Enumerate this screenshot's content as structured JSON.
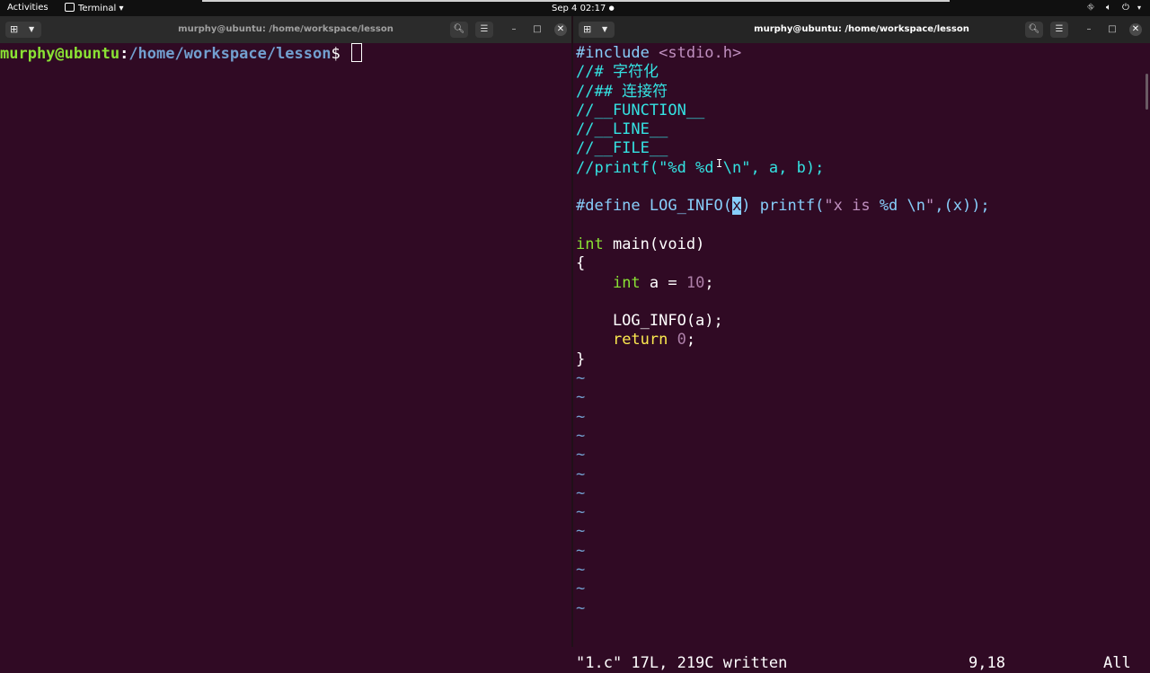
{
  "topbar": {
    "activities": "Activities",
    "app_menu": "Terminal",
    "app_menu_caret": "▾",
    "datetime": "Sep 4  02:17",
    "indicator": "●"
  },
  "left_terminal": {
    "title": "murphy@ubuntu: /home/workspace/lesson",
    "prompt_user": "murphy@ubuntu",
    "prompt_colon": ":",
    "prompt_path": "/home/workspace/lesson",
    "prompt_suffix": "$ "
  },
  "right_terminal": {
    "title": "murphy@ubuntu: /home/workspace/lesson",
    "code": [
      [
        {
          "t": "#include ",
          "c": "c-pre"
        },
        {
          "t": "<stdio.h>",
          "c": "c-str"
        }
      ],
      [
        {
          "t": "//# 字符化",
          "c": "c-cmt"
        }
      ],
      [
        {
          "t": "//## 连接符",
          "c": "c-cmt"
        }
      ],
      [
        {
          "t": "//__FUNCTION__",
          "c": "c-cmt"
        }
      ],
      [
        {
          "t": "//__LINE__",
          "c": "c-cmt"
        }
      ],
      [
        {
          "t": "//__FILE__",
          "c": "c-cmt"
        }
      ],
      [
        {
          "t": "//printf(\"%d %d \\n\", a, b);",
          "c": "c-cmt"
        }
      ],
      [],
      [
        {
          "t": "#define LOG_INFO(",
          "c": "c-pre"
        },
        {
          "t": "x",
          "c": "c-pre cur"
        },
        {
          "t": ") ",
          "c": "c-pre"
        },
        {
          "t": "printf(",
          "c": "c-pre"
        },
        {
          "t": "\"x is ",
          "c": "c-str"
        },
        {
          "t": "%d \\n",
          "c": "c-pre"
        },
        {
          "t": "\"",
          "c": "c-str"
        },
        {
          "t": ",(x));",
          "c": "c-pre"
        }
      ],
      [],
      [
        {
          "t": "int",
          "c": "c-type"
        },
        {
          "t": " main(void)",
          "c": ""
        }
      ],
      [
        {
          "t": "{",
          "c": ""
        }
      ],
      [
        {
          "t": "    ",
          "c": ""
        },
        {
          "t": "int",
          "c": "c-type"
        },
        {
          "t": " a = ",
          "c": ""
        },
        {
          "t": "10",
          "c": "c-num"
        },
        {
          "t": ";",
          "c": ""
        }
      ],
      [],
      [
        {
          "t": "    LOG_INFO(a);",
          "c": ""
        }
      ],
      [
        {
          "t": "    ",
          "c": ""
        },
        {
          "t": "return",
          "c": "c-kw"
        },
        {
          "t": " ",
          "c": ""
        },
        {
          "t": "0",
          "c": "c-num"
        },
        {
          "t": ";",
          "c": ""
        }
      ],
      [
        {
          "t": "}",
          "c": ""
        }
      ],
      [
        {
          "t": "~",
          "c": "c-tilde"
        }
      ],
      [
        {
          "t": "~",
          "c": "c-tilde"
        }
      ],
      [
        {
          "t": "~",
          "c": "c-tilde"
        }
      ],
      [
        {
          "t": "~",
          "c": "c-tilde"
        }
      ],
      [
        {
          "t": "~",
          "c": "c-tilde"
        }
      ],
      [
        {
          "t": "~",
          "c": "c-tilde"
        }
      ],
      [
        {
          "t": "~",
          "c": "c-tilde"
        }
      ],
      [
        {
          "t": "~",
          "c": "c-tilde"
        }
      ],
      [
        {
          "t": "~",
          "c": "c-tilde"
        }
      ],
      [
        {
          "t": "~",
          "c": "c-tilde"
        }
      ],
      [
        {
          "t": "~",
          "c": "c-tilde"
        }
      ],
      [
        {
          "t": "~",
          "c": "c-tilde"
        }
      ],
      [
        {
          "t": "~",
          "c": "c-tilde"
        }
      ]
    ],
    "status_message": "\"1.c\" 17L, 219C written",
    "cursor_position": "9,18",
    "scroll_percent": "All"
  },
  "icons": {
    "new_tab": "new-tab-icon",
    "dropdown": "chevron-down-icon",
    "search": "search-icon",
    "menu": "hamburger-menu-icon",
    "minimize": "minimize-icon",
    "maximize": "maximize-icon",
    "close": "close-icon",
    "network": "network-icon",
    "volume": "volume-icon",
    "power": "power-icon"
  }
}
